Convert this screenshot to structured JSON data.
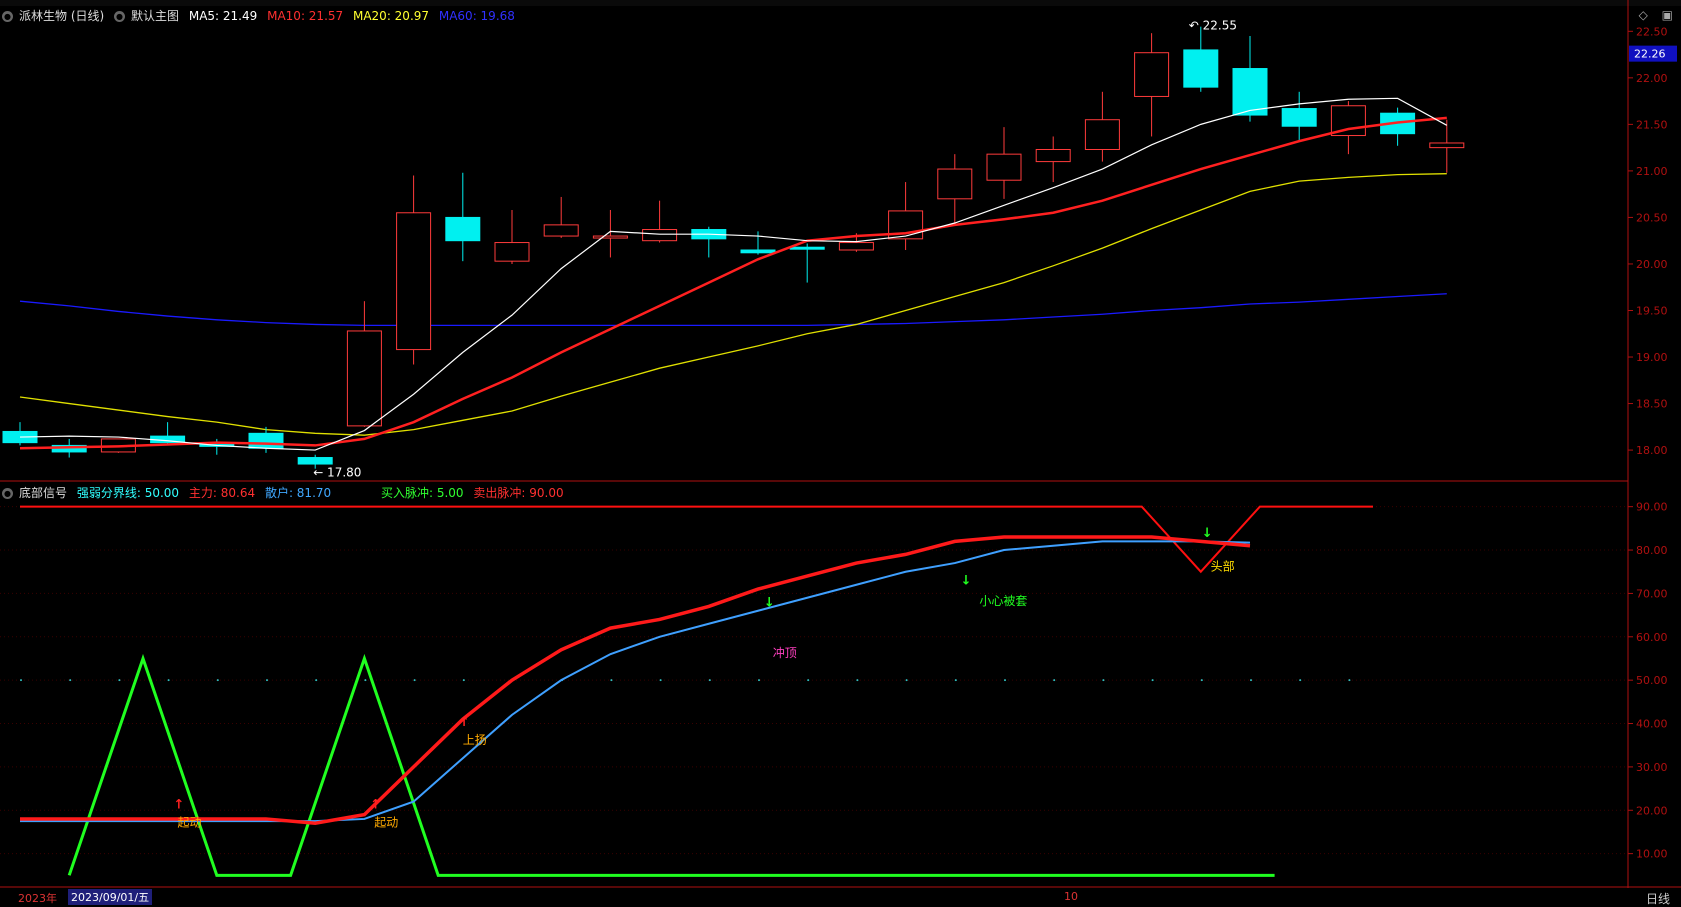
{
  "main_legend": {
    "title": "派林生物 (日线)",
    "layout_name": "默认主图",
    "ma5": "MA5: 21.49",
    "ma10": "MA10: 21.57",
    "ma20": "MA20: 20.97",
    "ma60": "MA60: 19.68"
  },
  "sub_legend": {
    "title": "底部信号",
    "threshold": "强弱分界线: 50.00",
    "main_force": "主力: 80.64",
    "retail": "散户: 81.70",
    "buy_pulse": "买入脉冲: 5.00",
    "sell_pulse": "卖出脉冲: 90.00"
  },
  "bottom": {
    "year": "2023年",
    "date": "2023/09/01/五",
    "month": "10",
    "period": "日线"
  },
  "colors": {
    "up": "#ff3b3b",
    "down": "#00f0f0",
    "ma5": "#ffffff",
    "ma10": "#ff2020",
    "ma20": "#e0e000",
    "ma60": "#1a1aff",
    "main_force": "#ff1a1a",
    "retail": "#3fa0ff",
    "pulse": "#20ff20",
    "axis": "#b01010"
  },
  "chart_data": [
    {
      "type": "candlestick",
      "price_tag": "22.26",
      "high_label": "22.55",
      "low_label": "17.80",
      "ylim": [
        17.7,
        22.6
      ],
      "yticks": [
        "18.00",
        "18.50",
        "19.00",
        "19.50",
        "20.00",
        "20.50",
        "21.00",
        "21.50",
        "22.00",
        "22.50"
      ],
      "candles": [
        {
          "o": 18.2,
          "h": 18.3,
          "l": 18.05,
          "c": 18.08
        },
        {
          "o": 18.05,
          "h": 18.12,
          "l": 17.92,
          "c": 17.98
        },
        {
          "o": 17.98,
          "h": 18.12,
          "l": 17.97,
          "c": 18.12
        },
        {
          "o": 18.15,
          "h": 18.3,
          "l": 18.07,
          "c": 18.08
        },
        {
          "o": 18.08,
          "h": 18.12,
          "l": 17.95,
          "c": 18.04
        },
        {
          "o": 18.18,
          "h": 18.25,
          "l": 17.97,
          "c": 18.02
        },
        {
          "o": 17.92,
          "h": 17.95,
          "l": 17.8,
          "c": 17.85
        },
        {
          "o": 18.26,
          "h": 19.6,
          "l": 18.25,
          "c": 19.28
        },
        {
          "o": 19.08,
          "h": 20.95,
          "l": 18.92,
          "c": 20.55
        },
        {
          "o": 20.5,
          "h": 20.98,
          "l": 20.03,
          "c": 20.25
        },
        {
          "o": 20.03,
          "h": 20.58,
          "l": 20.0,
          "c": 20.23
        },
        {
          "o": 20.3,
          "h": 20.72,
          "l": 20.28,
          "c": 20.42
        },
        {
          "o": 20.28,
          "h": 20.58,
          "l": 20.07,
          "c": 20.3
        },
        {
          "o": 20.25,
          "h": 20.68,
          "l": 20.23,
          "c": 20.37
        },
        {
          "o": 20.37,
          "h": 20.4,
          "l": 20.07,
          "c": 20.27
        },
        {
          "o": 20.15,
          "h": 20.35,
          "l": 20.1,
          "c": 20.12
        },
        {
          "o": 20.18,
          "h": 20.22,
          "l": 19.8,
          "c": 20.16
        },
        {
          "o": 20.15,
          "h": 20.33,
          "l": 20.13,
          "c": 20.23
        },
        {
          "o": 20.27,
          "h": 20.88,
          "l": 20.15,
          "c": 20.57
        },
        {
          "o": 20.7,
          "h": 21.18,
          "l": 20.42,
          "c": 21.02
        },
        {
          "o": 20.9,
          "h": 21.47,
          "l": 20.7,
          "c": 21.18
        },
        {
          "o": 21.1,
          "h": 21.37,
          "l": 20.88,
          "c": 21.23
        },
        {
          "o": 21.23,
          "h": 21.85,
          "l": 21.1,
          "c": 21.55
        },
        {
          "o": 21.8,
          "h": 22.48,
          "l": 21.37,
          "c": 22.27
        },
        {
          "o": 22.3,
          "h": 22.55,
          "l": 21.85,
          "c": 21.9
        },
        {
          "o": 22.1,
          "h": 22.45,
          "l": 21.53,
          "c": 21.6
        },
        {
          "o": 21.67,
          "h": 21.85,
          "l": 21.32,
          "c": 21.48
        },
        {
          "o": 21.38,
          "h": 21.75,
          "l": 21.18,
          "c": 21.7
        },
        {
          "o": 21.62,
          "h": 21.68,
          "l": 21.27,
          "c": 21.4
        },
        {
          "o": 21.25,
          "h": 21.55,
          "l": 20.98,
          "c": 21.3
        }
      ],
      "ma5": [
        18.14,
        18.15,
        18.14,
        18.1,
        18.05,
        18.02,
        18.0,
        18.21,
        18.6,
        19.05,
        19.45,
        19.95,
        20.35,
        20.32,
        20.32,
        20.3,
        20.25,
        20.24,
        20.3,
        20.44,
        20.63,
        20.82,
        21.02,
        21.28,
        21.5,
        21.65,
        21.72,
        21.77,
        21.78,
        21.49
      ],
      "ma10": [
        18.02,
        18.03,
        18.04,
        18.06,
        18.08,
        18.07,
        18.05,
        18.12,
        18.3,
        18.55,
        18.78,
        19.05,
        19.3,
        19.55,
        19.8,
        20.05,
        20.25,
        20.3,
        20.33,
        20.42,
        20.48,
        20.55,
        20.68,
        20.85,
        21.02,
        21.17,
        21.32,
        21.45,
        21.52,
        21.57
      ],
      "ma20": [
        18.57,
        18.5,
        18.43,
        18.36,
        18.3,
        18.22,
        18.18,
        18.16,
        18.22,
        18.32,
        18.42,
        18.58,
        18.73,
        18.88,
        19.0,
        19.12,
        19.25,
        19.35,
        19.5,
        19.65,
        19.8,
        19.98,
        20.17,
        20.38,
        20.58,
        20.78,
        20.89,
        20.93,
        20.96,
        20.97
      ],
      "ma60": [
        19.6,
        19.55,
        19.49,
        19.44,
        19.4,
        19.37,
        19.35,
        19.34,
        19.34,
        19.34,
        19.34,
        19.34,
        19.34,
        19.34,
        19.34,
        19.34,
        19.34,
        19.35,
        19.36,
        19.38,
        19.4,
        19.43,
        19.46,
        19.5,
        19.53,
        19.57,
        19.59,
        19.62,
        19.65,
        19.68
      ]
    },
    {
      "type": "line",
      "ylim": [
        3,
        92
      ],
      "yticks": [
        "10.00",
        "20.00",
        "30.00",
        "40.00",
        "50.00",
        "60.00",
        "70.00",
        "80.00",
        "90.00"
      ],
      "threshold": 50,
      "main_force": [
        18,
        18,
        18,
        18,
        18,
        18,
        17,
        19,
        30,
        41,
        50,
        57,
        62,
        64,
        67,
        71,
        74,
        77,
        79,
        82,
        83,
        83,
        83,
        83,
        82,
        81
      ],
      "retail": [
        17.5,
        17.5,
        17.5,
        17.5,
        17.5,
        17.5,
        17.5,
        18,
        22,
        32,
        42,
        50,
        56,
        60,
        63,
        66,
        69,
        72,
        75,
        77,
        80,
        81,
        82,
        82,
        82,
        81.7
      ],
      "pulse": [
        {
          "x": 1,
          "y": 5
        },
        {
          "x": 2.5,
          "y": 55
        },
        {
          "x": 4,
          "y": 5
        },
        {
          "x": 5.5,
          "y": 5
        },
        {
          "x": 7,
          "y": 55
        },
        {
          "x": 8.5,
          "y": 5
        },
        {
          "x": 25.5,
          "y": 5
        }
      ],
      "sell_pulse": [
        {
          "x": 0,
          "y": 90
        },
        {
          "x": 22.8,
          "y": 90
        },
        {
          "x": 24,
          "y": 75
        },
        {
          "x": 25.2,
          "y": 90
        },
        {
          "x": 27.5,
          "y": 90
        }
      ],
      "annotations": [
        {
          "x": 3.2,
          "y": 20,
          "text": "起动",
          "color": "#ffaa00",
          "arrow": "up",
          "arrow_color": "#ff2020"
        },
        {
          "x": 7.2,
          "y": 20,
          "text": "起动",
          "color": "#ffaa00",
          "arrow": "up",
          "arrow_color": "#ff2020"
        },
        {
          "x": 9.0,
          "y": 39,
          "text": "上扬",
          "color": "#ffaa00",
          "arrow": "up",
          "arrow_color": "#ff2020"
        },
        {
          "x": 15.3,
          "y": 59,
          "text": "冲顶",
          "color": "#ff40c0",
          "arrow": "none",
          "arrow_color": ""
        },
        {
          "x": 19.5,
          "y": 71,
          "text": "小心被套",
          "color": "#20ff20",
          "arrow": "none",
          "arrow_color": ""
        },
        {
          "x": 24.2,
          "y": 79,
          "text": "头部",
          "color": "#ffdd00",
          "arrow": "none",
          "arrow_color": ""
        }
      ],
      "down_arrows": [
        15.2,
        19.2,
        24.1
      ]
    }
  ]
}
